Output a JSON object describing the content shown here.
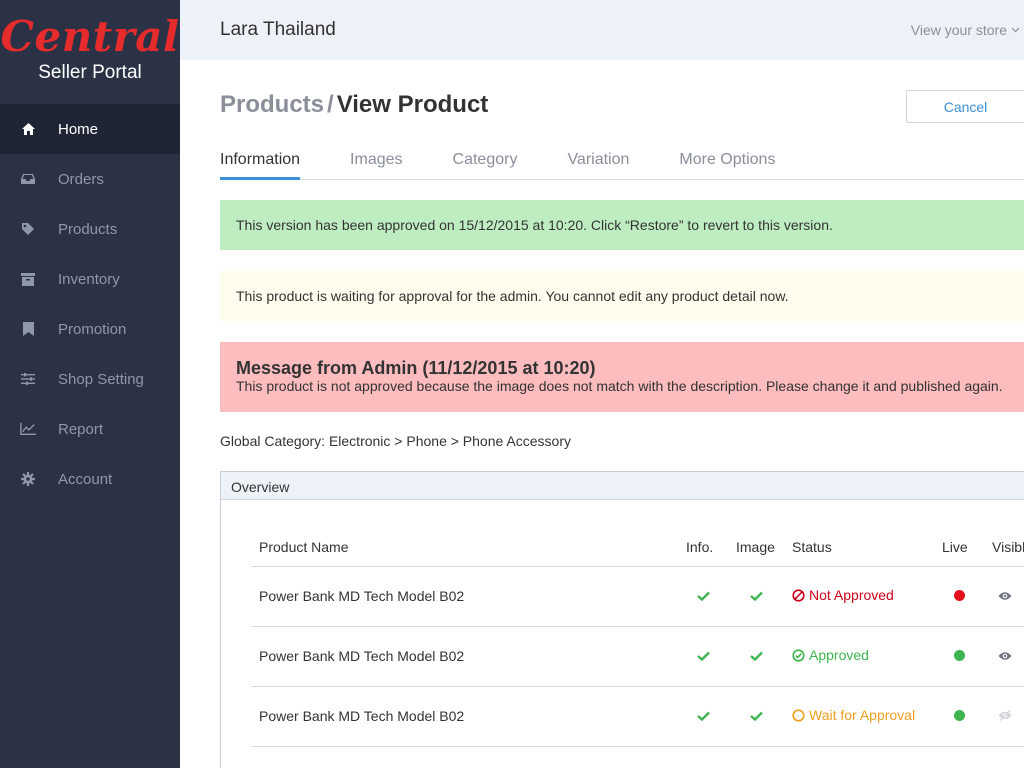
{
  "brand": {
    "logo": "Central",
    "subtitle": "Seller Portal"
  },
  "header": {
    "store_name": "Lara Thailand",
    "store_link": "View your store"
  },
  "nav": [
    {
      "label": "Home",
      "icon": "home-icon"
    },
    {
      "label": "Orders",
      "icon": "inbox-icon"
    },
    {
      "label": "Products",
      "icon": "tag-icon"
    },
    {
      "label": "Inventory",
      "icon": "archive-icon"
    },
    {
      "label": "Promotion",
      "icon": "bookmark-icon"
    },
    {
      "label": "Shop Setting",
      "icon": "sliders-icon"
    },
    {
      "label": "Report",
      "icon": "line-chart-icon"
    },
    {
      "label": "Account",
      "icon": "gear-icon"
    }
  ],
  "page": {
    "breadcrumb_parent": "Products",
    "breadcrumb_sep": "/",
    "title": "View Product",
    "cancel_label": "Cancel"
  },
  "tabs": [
    "Information",
    "Images",
    "Category",
    "Variation",
    "More Options"
  ],
  "alerts": {
    "success": "This version has been approved on 15/12/2015 at 10:20. Click “Restore” to revert to this version.",
    "warning": "This product is waiting for approval for the admin. You cannot edit any product detail now.",
    "danger_title": "Message from Admin (11/12/2015 at 10:20)",
    "danger_body": "This product is not approved because the image does not match with the description. Please change it and published again."
  },
  "global_category": "Global Category: Electronic > Phone > Phone Accessory",
  "overview": {
    "title": "Overview",
    "columns": [
      "Product Name",
      "Info.",
      "Image",
      "Status",
      "Live",
      "Visible"
    ],
    "rows": [
      {
        "name": "Power Bank MD Tech Model B02",
        "info_ok": true,
        "image_ok": true,
        "status": "Not Approved",
        "status_type": "not-approved",
        "live": "red",
        "visible": true
      },
      {
        "name": "Power Bank MD Tech Model B02",
        "info_ok": true,
        "image_ok": true,
        "status": "Approved",
        "status_type": "approved",
        "live": "green",
        "visible": true
      },
      {
        "name": "Power Bank MD Tech Model B02",
        "info_ok": true,
        "image_ok": true,
        "status": "Wait for Approval",
        "status_type": "waiting",
        "live": "green",
        "visible": false
      }
    ]
  },
  "colors": {
    "sidebar_bg": "#2b3245",
    "accent": "#3d8fd6",
    "brand_red": "#e52b2b",
    "success_bg": "#bfedc2",
    "warning_bg": "#fefded",
    "danger_bg": "#fdbcbd",
    "status_red": "#d0021b",
    "status_green": "#3fb551",
    "status_orange": "#f0a020"
  }
}
